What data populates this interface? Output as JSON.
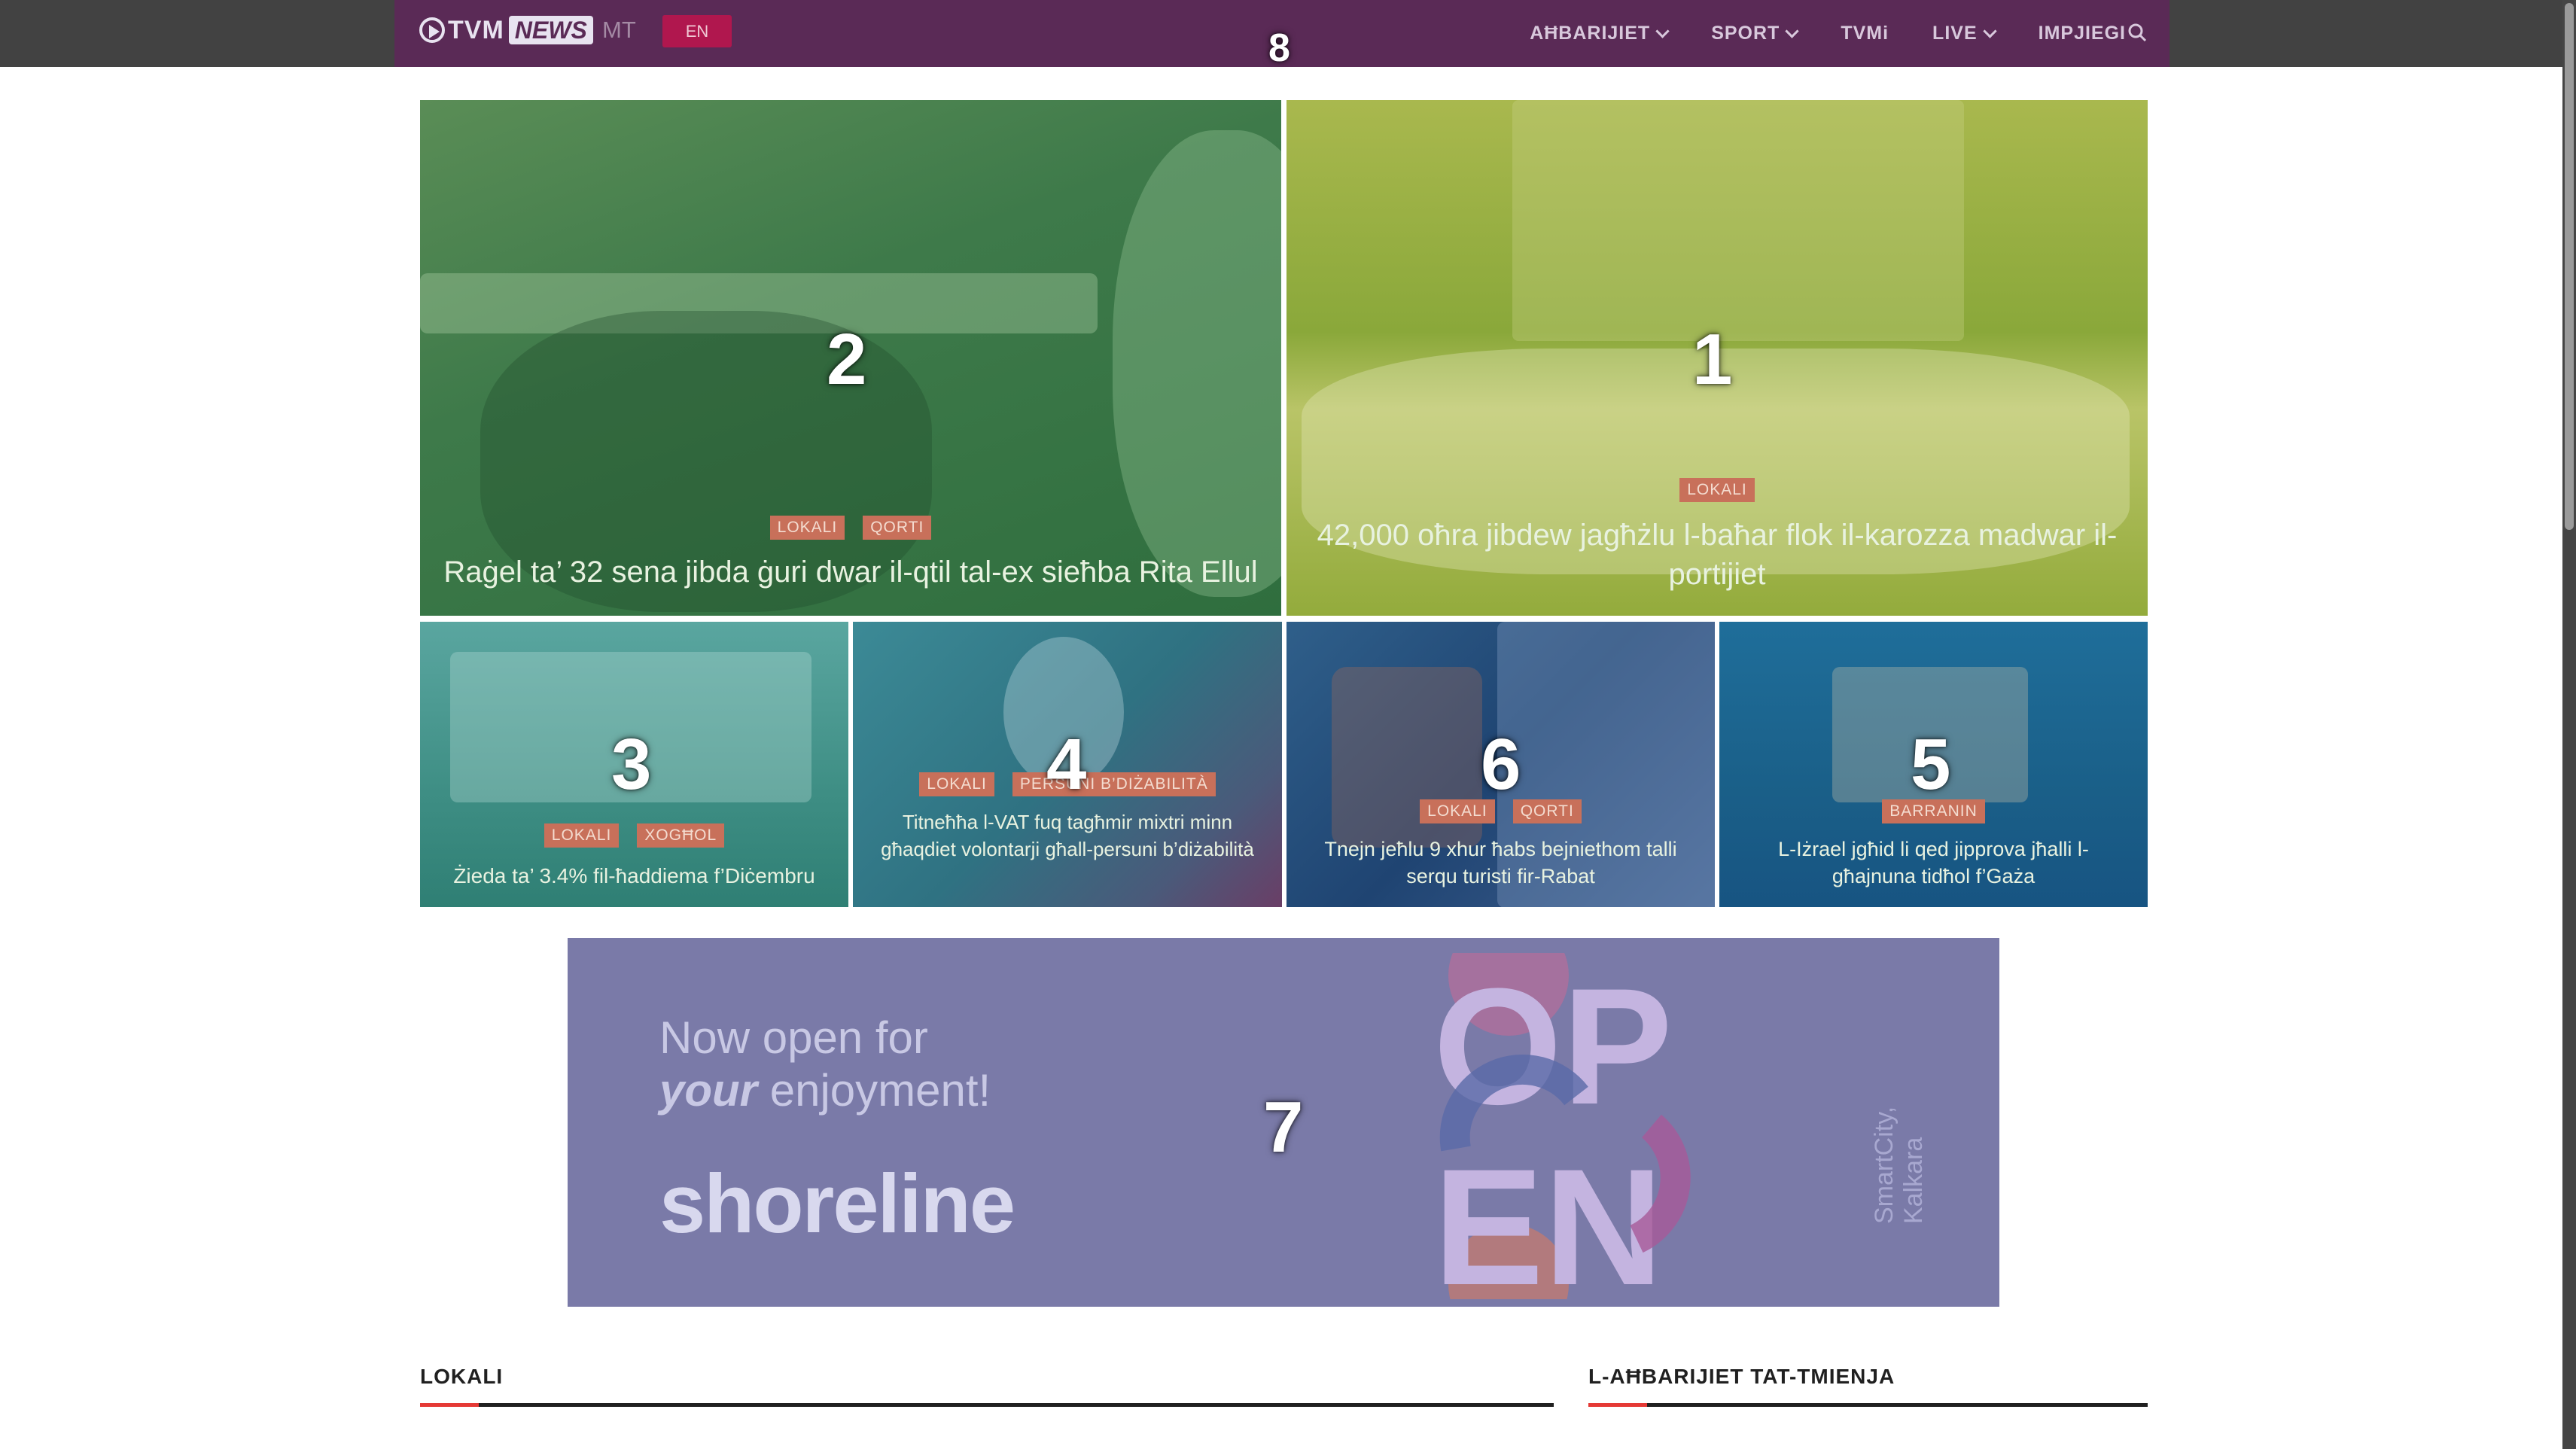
{
  "nav": {
    "logo_tvm": "TVM",
    "logo_news": "NEWS",
    "lang_current": "MT",
    "lang_switch": "EN",
    "items": [
      {
        "label": "AĦBARIJIET",
        "dropdown": true
      },
      {
        "label": "SPORT",
        "dropdown": true
      },
      {
        "label": "TVMi",
        "dropdown": false
      },
      {
        "label": "LIVE",
        "dropdown": true
      },
      {
        "label": "IMPJIEGI",
        "dropdown": false
      }
    ]
  },
  "overlay_numbers": {
    "n1": "1",
    "n2": "2",
    "n3": "3",
    "n4": "4",
    "n5": "5",
    "n6": "6",
    "n7": "7",
    "n8": "8"
  },
  "featured": {
    "card2": {
      "categories": [
        "LOKALI",
        "QORTI"
      ],
      "title": "Raġel ta’ 32 sena jibda ġuri dwar il-qtil tal-ex sieħba Rita Ellul"
    },
    "card1": {
      "categories": [
        "LOKALI"
      ],
      "title": "42,000 oħra jibdew jagħżlu l-baħar flok il-karozza madwar il-portijiet"
    },
    "card3": {
      "categories": [
        "LOKALI",
        "XOGĦOL"
      ],
      "title": "Żieda ta’ 3.4% fil-ħaddiema f’Diċembru"
    },
    "card4": {
      "categories": [
        "LOKALI",
        "PERSUNI B’DIŻABILITÀ"
      ],
      "title": "Titneħħa l-VAT fuq tagħmir mixtri minn għaqdiet volontarji għall-persuni b’diżabilità"
    },
    "card6": {
      "categories": [
        "LOKALI",
        "QORTI"
      ],
      "title": "Tnejn jeħlu 9 xhur ħabs bejniethom talli serqu turisti fir-Rabat"
    },
    "card5": {
      "categories": [
        "BARRANIN"
      ],
      "title": "L-Iżrael jgħid li qed jipprova jħalli l-għajnuna tidħol f’Gaża"
    }
  },
  "ad": {
    "line1": "Now open for",
    "line2_em": "your",
    "line2_rest": " enjoyment!",
    "brand": "shoreline",
    "side_text": "SmartCity, Kalkara",
    "open_word": "OPEN"
  },
  "sections": {
    "left": "LOKALI",
    "right": "L-AĦBARIJIET TAT-TMIENJA"
  },
  "colors": {
    "nav_bg": "#5a2a56",
    "accent_red": "#e53935",
    "category_badge": "#c8705a"
  }
}
